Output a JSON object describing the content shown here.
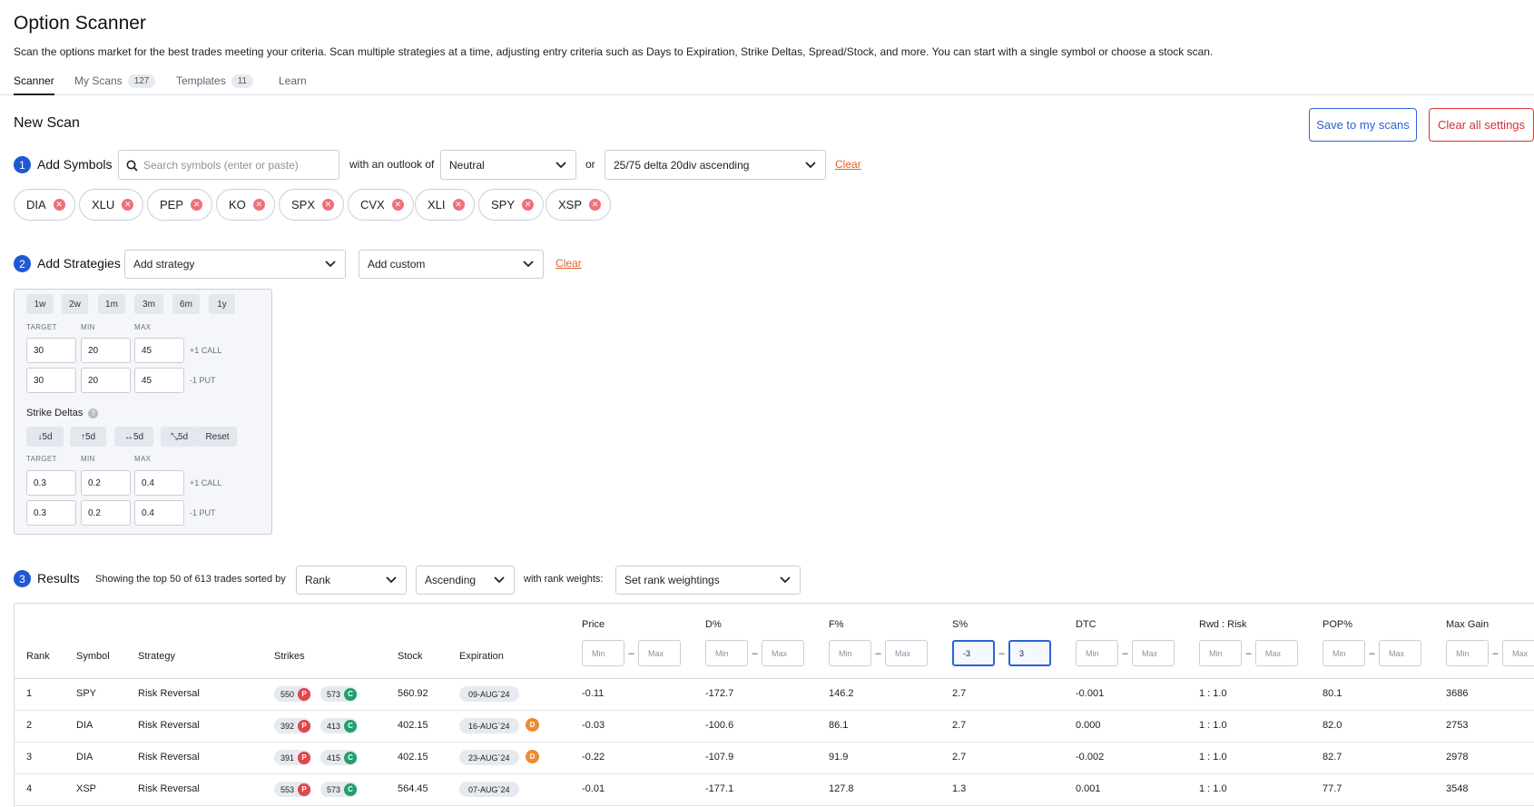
{
  "page": {
    "title": "Option Scanner",
    "description": "Scan the options market for the best trades meeting your criteria. Scan multiple strategies at a time, adjusting entry criteria such as Days to Expiration, Strike Deltas, Spread/Stock, and more. You can start with a single symbol or choose a stock scan."
  },
  "tabs": [
    {
      "label": "Scanner",
      "count": null
    },
    {
      "label": "My Scans",
      "count": "127"
    },
    {
      "label": "Templates",
      "count": "11"
    },
    {
      "label": "Learn",
      "count": null
    }
  ],
  "new_scan": {
    "title": "New Scan",
    "save_label": "Save to my scans",
    "clear_all_label": "Clear all settings"
  },
  "step1": {
    "num": "1",
    "label": "Add Symbols",
    "search_placeholder": "Search symbols (enter or paste)",
    "outlook_label": "with an outlook of",
    "outlook_value": "Neutral",
    "or_label": "or",
    "scan_value": "25/75 delta 20div ascending",
    "clear_label": "Clear",
    "symbols": [
      "DIA",
      "XLU",
      "PEP",
      "KO",
      "SPX",
      "CVX",
      "XLI",
      "SPY",
      "XSP"
    ]
  },
  "step2": {
    "num": "2",
    "label": "Add Strategies",
    "strategy_select": "Add strategy",
    "custom_select": "Add custom",
    "clear_label": "Clear",
    "dte_buttons": [
      "1w",
      "2w",
      "1m",
      "3m",
      "6m",
      "1y"
    ],
    "col_labels": {
      "target": "TARGET",
      "min": "MIN",
      "max": "MAX"
    },
    "dte_rows": [
      {
        "target": "30",
        "min": "20",
        "max": "45",
        "leg": "+1 CALL"
      },
      {
        "target": "30",
        "min": "20",
        "max": "45",
        "leg": "-1 PUT"
      }
    ],
    "strike_deltas_label": "Strike Deltas",
    "help_glyph": "?",
    "delta_buttons": [
      "↓5d",
      "↑5d",
      "↔5d",
      "⤡5d",
      "Reset"
    ],
    "delta_rows": [
      {
        "target": "0.3",
        "min": "0.2",
        "max": "0.4",
        "leg": "+1 CALL"
      },
      {
        "target": "0.3",
        "min": "0.2",
        "max": "0.4",
        "leg": "-1 PUT"
      }
    ]
  },
  "step3": {
    "num": "3",
    "label": "Results",
    "showing_text": "Showing the top 50 of 613 trades sorted by",
    "sort_value": "Rank",
    "order_value": "Ascending",
    "weights_label": "with rank weights:",
    "weights_value": "Set rank weightings"
  },
  "table": {
    "headers": {
      "rank": "Rank",
      "symbol": "Symbol",
      "strategy": "Strategy",
      "strikes": "Strikes",
      "stock": "Stock",
      "expiration": "Expiration",
      "price": "Price",
      "d_pct": "D%",
      "f_pct": "F%",
      "s_pct": "S%",
      "dtc": "DTC",
      "rwd_risk": "Rwd : Risk",
      "pop_pct": "POP%",
      "max_gain": "Max Gain"
    },
    "range_min_placeholder": "Min",
    "range_max_placeholder": "Max",
    "s_pct_min": "-3",
    "s_pct_max": "3",
    "rows": [
      {
        "rank": "1",
        "symbol": "SPY",
        "strategy": "Risk Reversal",
        "strike_put": "550",
        "strike_call": "573",
        "stock": "560.92",
        "expiration": "09-AUG`24",
        "dividend": "",
        "price": "-0.11",
        "d_pct": "-172.7",
        "f_pct": "146.2",
        "s_pct": "2.7",
        "dtc": "-0.001",
        "rwd_risk": "1 : 1.0",
        "pop_pct": "80.1",
        "max_gain": "3686"
      },
      {
        "rank": "2",
        "symbol": "DIA",
        "strategy": "Risk Reversal",
        "strike_put": "392",
        "strike_call": "413",
        "stock": "402.15",
        "expiration": "16-AUG`24",
        "dividend": "D",
        "price": "-0.03",
        "d_pct": "-100.6",
        "f_pct": "86.1",
        "s_pct": "2.7",
        "dtc": "0.000",
        "rwd_risk": "1 : 1.0",
        "pop_pct": "82.0",
        "max_gain": "2753"
      },
      {
        "rank": "3",
        "symbol": "DIA",
        "strategy": "Risk Reversal",
        "strike_put": "391",
        "strike_call": "415",
        "stock": "402.15",
        "expiration": "23-AUG`24",
        "dividend": "D",
        "price": "-0.22",
        "d_pct": "-107.9",
        "f_pct": "91.9",
        "s_pct": "2.7",
        "dtc": "-0.002",
        "rwd_risk": "1 : 1.0",
        "pop_pct": "82.7",
        "max_gain": "2978"
      },
      {
        "rank": "4",
        "symbol": "XSP",
        "strategy": "Risk Reversal",
        "strike_put": "553",
        "strike_call": "573",
        "stock": "564.45",
        "expiration": "07-AUG`24",
        "dividend": "",
        "price": "-0.01",
        "d_pct": "-177.1",
        "f_pct": "127.8",
        "s_pct": "1.3",
        "dtc": "0.001",
        "rwd_risk": "1 : 1.0",
        "pop_pct": "77.7",
        "max_gain": "3548"
      }
    ],
    "put_glyph": "P",
    "call_glyph": "C"
  },
  "colors": {
    "accent_blue": "#2057d6",
    "danger_red": "#d93030",
    "link_orange": "#e0632a",
    "put_red": "#e0474c",
    "call_green": "#23a06a",
    "dividend_orange": "#ee8a2f"
  },
  "icons": {
    "search": "search-icon",
    "chevron": "chevron-down-icon",
    "remove": "remove-chip-icon",
    "help": "help-icon"
  }
}
